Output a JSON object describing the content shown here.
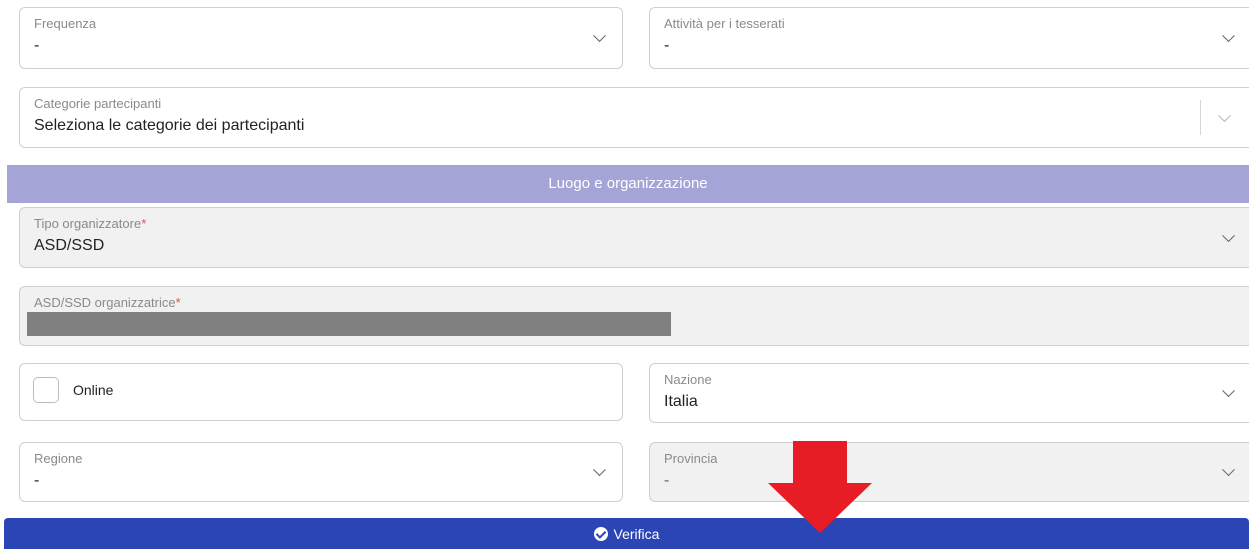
{
  "form": {
    "frequenza": {
      "label": "Frequenza",
      "value": "-"
    },
    "attivita_tesserati": {
      "label": "Attività per i tesserati",
      "value": "-"
    },
    "categorie_partecipanti": {
      "label": "Categorie partecipanti",
      "placeholder": "Seleziona le categorie dei partecipanti"
    }
  },
  "section": {
    "title": "Luogo e organizzazione"
  },
  "organizzazione": {
    "tipo_organizzatore": {
      "label": "Tipo organizzatore",
      "required_mark": "*",
      "value": "ASD/SSD"
    },
    "asd_ssd_organizzatrice": {
      "label": "ASD/SSD organizzatrice",
      "required_mark": "*"
    },
    "online": {
      "label": "Online",
      "checked": false
    },
    "nazione": {
      "label": "Nazione",
      "value": "Italia"
    },
    "regione": {
      "label": "Regione",
      "value": "-"
    },
    "provincia": {
      "label": "Provincia",
      "value": "-"
    }
  },
  "actions": {
    "verifica_label": "Verifica"
  },
  "colors": {
    "section_bar": "#a4a4d6",
    "primary_button": "#2b46b4",
    "annotation_arrow": "#e81c24",
    "required": "#d9534f"
  },
  "icons": {
    "dropdown": "chevron-down-icon",
    "verify": "check-circle-icon",
    "annotation": "red-arrow-down-icon"
  }
}
